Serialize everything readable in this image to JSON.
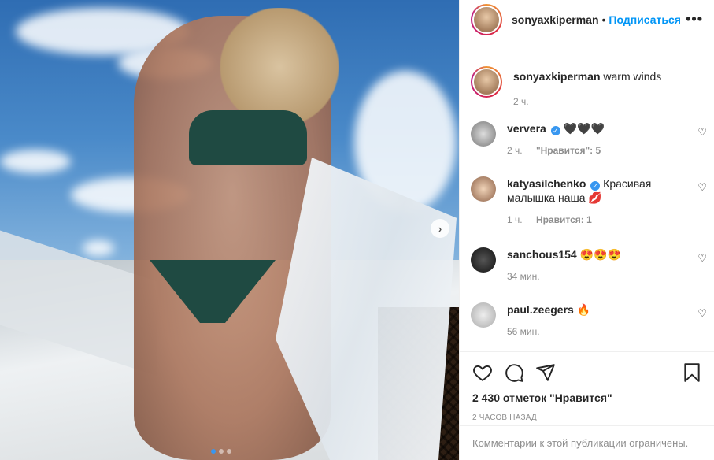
{
  "post": {
    "author": "sonyaxkiperman",
    "separator": "•",
    "follow_label": "Подписаться",
    "more_label": "•••",
    "carousel_next_label": "›",
    "caption": {
      "username": "sonyaxkiperman",
      "text": "warm winds",
      "time": "2 ч."
    }
  },
  "comments": [
    {
      "username": "ververa",
      "verified": true,
      "text": "🖤🖤🖤",
      "time": "2 ч.",
      "likes": "\"Нравится\": 5"
    },
    {
      "username": "katyasilchenko",
      "verified": true,
      "text": "Красивая малышка наша 💋",
      "time": "1 ч.",
      "likes": "Нравится: 1"
    },
    {
      "username": "sanchous154",
      "verified": false,
      "text": "😍😍😍",
      "time": "34 мин.",
      "likes": ""
    },
    {
      "username": "paul.zeegers",
      "verified": false,
      "text": "🔥",
      "time": "56 мин.",
      "likes": ""
    }
  ],
  "icons": {
    "verified": "✓",
    "heart_small": "♡"
  },
  "footer": {
    "likes_count": "2 430 отметок \"Нравится\"",
    "time_ago": "2 часов назад",
    "restricted_notice": "Комментарии к этой публикации ограничены."
  },
  "colors": {
    "accent": "#0095f6",
    "muted": "#8e8e8e",
    "text": "#262626"
  }
}
